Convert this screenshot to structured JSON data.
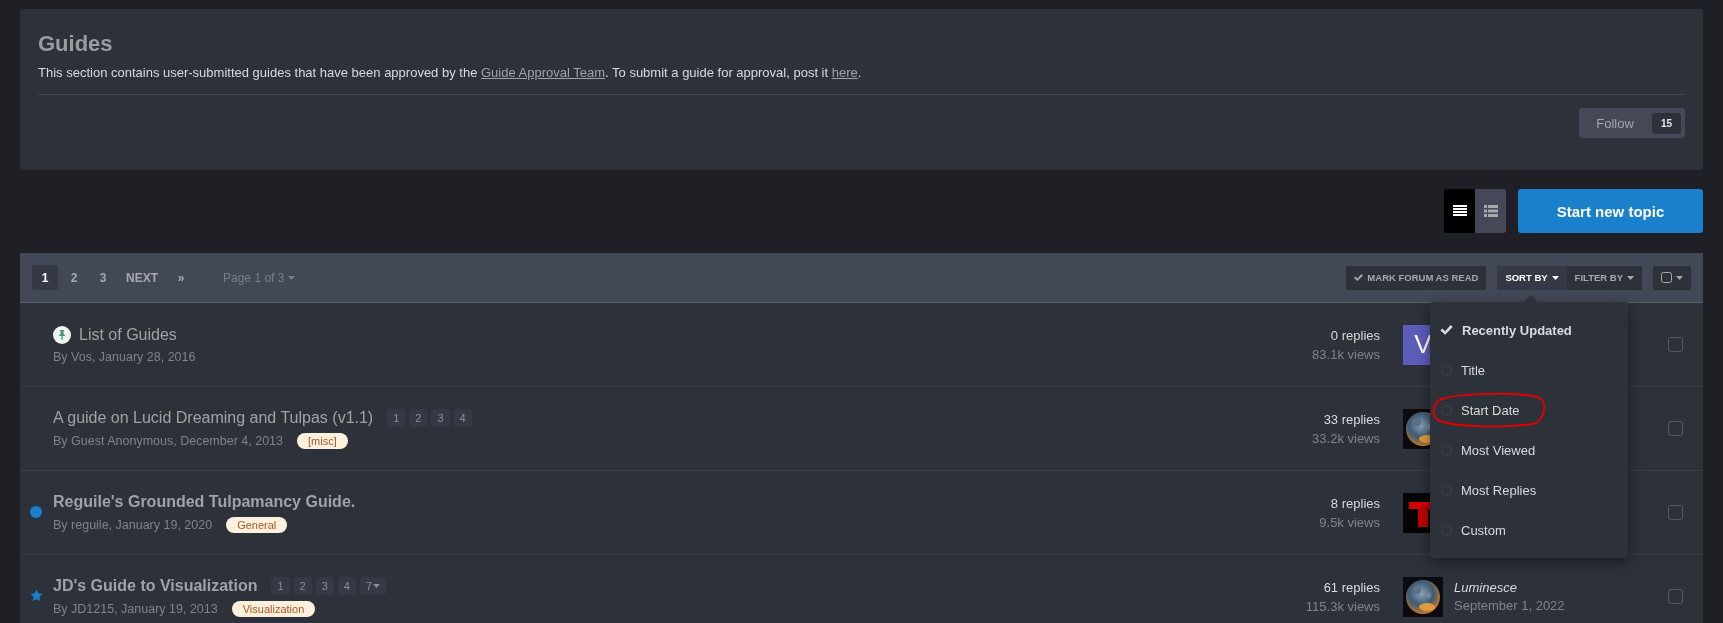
{
  "header": {
    "title": "Guides",
    "description": {
      "before": "This section contains user-submitted guides that have been approved by the ",
      "link": "Guide Approval Team",
      "middle": ". To submit a guide for approval, post it ",
      "link2": "here",
      "after": "."
    },
    "follow": {
      "label": "Follow",
      "count": "15"
    }
  },
  "view_toggle": [
    {
      "kind": "table",
      "selected": true
    },
    {
      "kind": "grid",
      "selected": false
    }
  ],
  "start_button": "Start new topic",
  "pagination": {
    "pages": [
      {
        "label": "1",
        "selected": true
      },
      {
        "label": "2",
        "selected": false
      },
      {
        "label": "3",
        "selected": false
      }
    ],
    "next": "NEXT",
    "last": "»",
    "page_select": "Page 1 of 3"
  },
  "actions": {
    "mark_read": "MARK FORUM AS READ",
    "sort": "SORT BY",
    "filter": "FILTER BY"
  },
  "sort_menu": {
    "options": [
      {
        "label": "Recently Updated",
        "selected": true,
        "circled": false
      },
      {
        "label": "Title",
        "selected": false,
        "circled": false
      },
      {
        "label": "Start Date",
        "selected": false,
        "circled": true
      },
      {
        "label": "Most Viewed",
        "selected": false,
        "circled": false
      },
      {
        "label": "Most Replies",
        "selected": false,
        "circled": false
      },
      {
        "label": "Custom",
        "selected": false,
        "circled": false
      }
    ]
  },
  "topics": [
    {
      "pinned": true,
      "starred": false,
      "unread": false,
      "title": "List of Guides",
      "byline": "By Vos, January 28, 2016",
      "replies": "0 replies",
      "views": "83.1k views",
      "avatar": {
        "kind": "letter",
        "letter": "V",
        "color": "#5c5db8"
      },
      "checked": false
    },
    {
      "pinned": false,
      "starred": false,
      "unread": false,
      "title": "A guide on Lucid Dreaming and Tulpas (v1.1)",
      "pages": [
        {
          "label": "1",
          "more": false
        },
        {
          "label": "2",
          "more": false
        },
        {
          "label": "3",
          "more": false
        },
        {
          "label": "4",
          "more": false
        }
      ],
      "byline": "By Guest Anonymous, December 4, 2013",
      "tag": "[misc]",
      "replies": "33 replies",
      "views": "33.2k views",
      "avatar": {
        "kind": "moon"
      },
      "checked": false
    },
    {
      "pinned": false,
      "starred": false,
      "unread": true,
      "title": "Reguile's Grounded Tulpamancy Guide.",
      "byline": "By reguile, January 19, 2020",
      "tag": "General",
      "replies": "8 replies",
      "views": "9.5k views",
      "avatar": {
        "kind": "red"
      },
      "checked": false
    },
    {
      "pinned": false,
      "starred": true,
      "unread": true,
      "title": "JD's Guide to Visualization",
      "pages": [
        {
          "label": "1",
          "more": false
        },
        {
          "label": "2",
          "more": false
        },
        {
          "label": "3",
          "more": false
        },
        {
          "label": "4",
          "more": false
        },
        {
          "label": "7",
          "more": true
        }
      ],
      "byline": "By JD1215, January 19, 2013",
      "tag": "Visualization",
      "replies": "61 replies",
      "views": "115.3k views",
      "avatar": {
        "kind": "moon"
      },
      "last_poster": "Luminesce",
      "last_date": "September 1, 2022",
      "checked": false
    }
  ]
}
